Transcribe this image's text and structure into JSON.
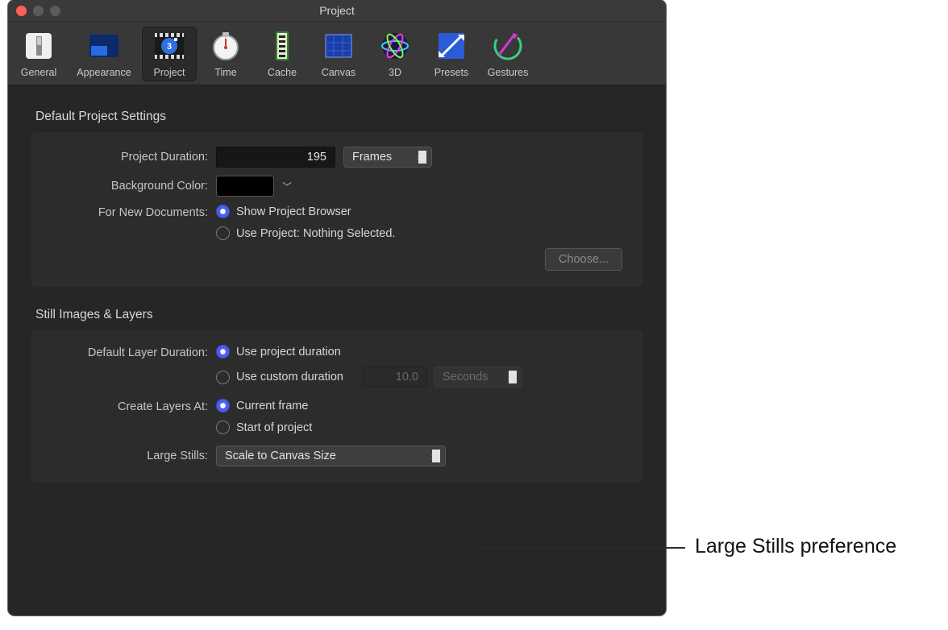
{
  "window": {
    "title": "Project"
  },
  "toolbar": {
    "items": [
      {
        "label": "General"
      },
      {
        "label": "Appearance"
      },
      {
        "label": "Project"
      },
      {
        "label": "Time"
      },
      {
        "label": "Cache"
      },
      {
        "label": "Canvas"
      },
      {
        "label": "3D"
      },
      {
        "label": "Presets"
      },
      {
        "label": "Gestures"
      }
    ],
    "selected": "Project"
  },
  "sections": {
    "defaults": {
      "title": "Default Project Settings",
      "duration_label": "Project Duration:",
      "duration_value": "195",
      "duration_unit": "Frames",
      "bgcolor_label": "Background Color:",
      "bgcolor_value": "#000000",
      "newdocs_label": "For New Documents:",
      "newdocs_options": {
        "show_browser": "Show Project Browser",
        "use_project": "Use Project: Nothing Selected."
      },
      "choose_button": "Choose..."
    },
    "stills": {
      "title": "Still Images & Layers",
      "layer_dur_label": "Default Layer Duration:",
      "layer_dur_options": {
        "use_project": "Use project duration",
        "custom": "Use custom duration"
      },
      "custom_value": "10.0",
      "custom_unit": "Seconds",
      "create_at_label": "Create Layers At:",
      "create_at_options": {
        "current": "Current frame",
        "start_proj": "Start of project"
      },
      "large_stills_label": "Large Stills:",
      "large_stills_value": "Scale to Canvas Size"
    }
  },
  "callout": "Large Stills preference"
}
